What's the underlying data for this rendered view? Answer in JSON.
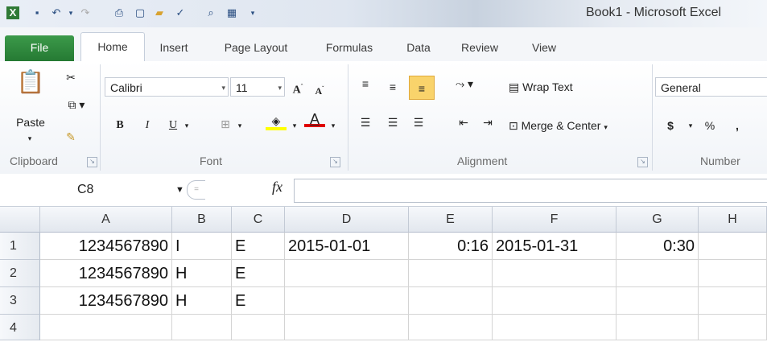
{
  "app": {
    "title": "Book1 - Microsoft Excel"
  },
  "tabs": [
    "File",
    "Home",
    "Insert",
    "Page Layout",
    "Formulas",
    "Data",
    "Review",
    "View"
  ],
  "ribbon": {
    "clipboard": {
      "paste": "Paste",
      "label": "Clipboard"
    },
    "font": {
      "family": "Calibri",
      "size": "11",
      "bold": "B",
      "italic": "I",
      "underline": "U",
      "label": "Font"
    },
    "alignment": {
      "wrap_text": "Wrap Text",
      "merge_center": "Merge & Center",
      "label": "Alignment"
    },
    "number": {
      "format": "General",
      "currency": "$",
      "percent": "%",
      "comma": ",",
      "label": "Number"
    }
  },
  "formula_bar": {
    "name_box": "C8",
    "fx": "fx",
    "content": ""
  },
  "columns": [
    "A",
    "B",
    "C",
    "D",
    "E",
    "F",
    "G",
    "H"
  ],
  "rows": [
    {
      "num": "1",
      "cells": [
        "1234567890",
        "I",
        "E",
        "2015-01-01",
        "0:16",
        "2015-01-31",
        "0:30",
        ""
      ]
    },
    {
      "num": "2",
      "cells": [
        "1234567890",
        "H",
        "E",
        "",
        "",
        "",
        "",
        ""
      ]
    },
    {
      "num": "3",
      "cells": [
        "1234567890",
        "H",
        "E",
        "",
        "",
        "",
        "",
        ""
      ]
    },
    {
      "num": "4",
      "cells": [
        "",
        "",
        "",
        "",
        "",
        "",
        "",
        ""
      ]
    }
  ],
  "colors": {
    "file_tab": "#2e7a3a",
    "highlight": "#ffff00",
    "font_color": "#e00000"
  }
}
